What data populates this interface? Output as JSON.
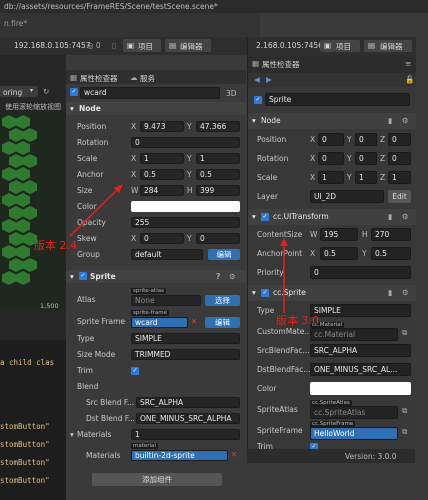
{
  "back_window": {
    "title_path": "db://assets/resources/FrameRES/Scene/testScene.scene*",
    "tab_file": "n.fire*",
    "ip": "192.168.0.105:7457",
    "ip_suffix": "◎ 0",
    "project_btn": "项目",
    "editor_btn": "编辑器",
    "toolbar_label": "oring",
    "toolbar_hint": "使用滚轮缩放视图",
    "grid_number": "1,500",
    "code_lines": [
      "a child clas",
      "stomButton\"",
      "stomButton\"",
      "stomButton\"",
      "stomButton\""
    ]
  },
  "left_inspector": {
    "tab_inspector": "属性检查器",
    "tab_service": "服务",
    "node_name": "wcard",
    "mode_3d": "3D",
    "node_section": "Node",
    "position": {
      "label": "Position",
      "x": "9.473",
      "y": "47.366"
    },
    "rotation": {
      "label": "Rotation",
      "value": "0"
    },
    "scale": {
      "label": "Scale",
      "x": "1",
      "y": "1"
    },
    "anchor": {
      "label": "Anchor",
      "x": "0.5",
      "y": "0.5"
    },
    "size": {
      "label": "Size",
      "w": "284",
      "h": "399"
    },
    "color_label": "Color",
    "opacity": {
      "label": "Opacity",
      "value": "255"
    },
    "skew": {
      "label": "Skew",
      "x": "0",
      "y": "0"
    },
    "group": {
      "label": "Group",
      "value": "default",
      "edit": "编辑"
    },
    "sprite_section": "Sprite",
    "atlas": {
      "label": "Atlas",
      "chip": "sprite-atlas",
      "value": "None",
      "btn": "选择"
    },
    "sprite_frame": {
      "label": "Sprite Frame",
      "chip": "sprite-frame",
      "value": "wcard",
      "btn": "编辑"
    },
    "type": {
      "label": "Type",
      "value": "SIMPLE"
    },
    "size_mode": {
      "label": "Size Mode",
      "value": "TRIMMED"
    },
    "trim_label": "Trim",
    "blend_label": "Blend",
    "src_blend": {
      "label": "Src Blend F...",
      "value": "SRC_ALPHA"
    },
    "dst_blend": {
      "label": "Dst Blend F...",
      "value": "ONE_MINUS_SRC_ALPHA"
    },
    "materials": {
      "label": "Materials",
      "count": "1"
    },
    "material_row": {
      "label": "Materials",
      "chip": "material",
      "value": "builtin-2d-sprite"
    },
    "add_component": "添加组件"
  },
  "right_window": {
    "ip": "2.168.0.105:7456",
    "project_btn": "项目",
    "editor_btn": "编辑器",
    "tab_inspector": "属性检查器",
    "node_name": "Sprite",
    "node_section": "Node",
    "position": {
      "label": "Position",
      "x": "0",
      "y": "0",
      "z": "0"
    },
    "rotation": {
      "label": "Rotation",
      "x": "0",
      "y": "0",
      "z": "0"
    },
    "scale": {
      "label": "Scale",
      "x": "1",
      "y": "1",
      "z": "1"
    },
    "layer": {
      "label": "Layer",
      "value": "UI_2D",
      "btn": "Edit"
    },
    "uitransform_section": "cc.UITransform",
    "content_size": {
      "label": "ContentSize",
      "w": "195",
      "h": "270"
    },
    "anchor_point": {
      "label": "AnchorPoint",
      "x": "0.5",
      "y": "0.5"
    },
    "priority": {
      "label": "Priority",
      "value": "0"
    },
    "sprite_section": "cc.Sprite",
    "type": {
      "label": "Type",
      "value": "SIMPLE"
    },
    "custom_material": {
      "label": "CustomMate...",
      "chip": "cc.Material",
      "value": "cc.Material"
    },
    "src_blend": {
      "label": "SrcBlendFac...",
      "value": "SRC_ALPHA"
    },
    "dst_blend": {
      "label": "DstBlendFac...",
      "value": "ONE_MINUS_SRC_AL..."
    },
    "color_label": "Color",
    "sprite_atlas": {
      "label": "SpriteAtlas",
      "chip": "cc.SpriteAtlas",
      "value": "cc.SpriteAtlas"
    },
    "sprite_frame": {
      "label": "SpriteFrame",
      "chip": "cc.SpriteFrame",
      "value": "HelloWorld"
    },
    "trim_label": "Trim",
    "version": "Version: 3.0.0"
  },
  "annotations": {
    "left": "版本 2.4",
    "right": "版本 3.0"
  },
  "colors": {
    "accent": "#2f7ad6",
    "annotation": "#e8201a",
    "orange_icon": "#e88a2a"
  }
}
